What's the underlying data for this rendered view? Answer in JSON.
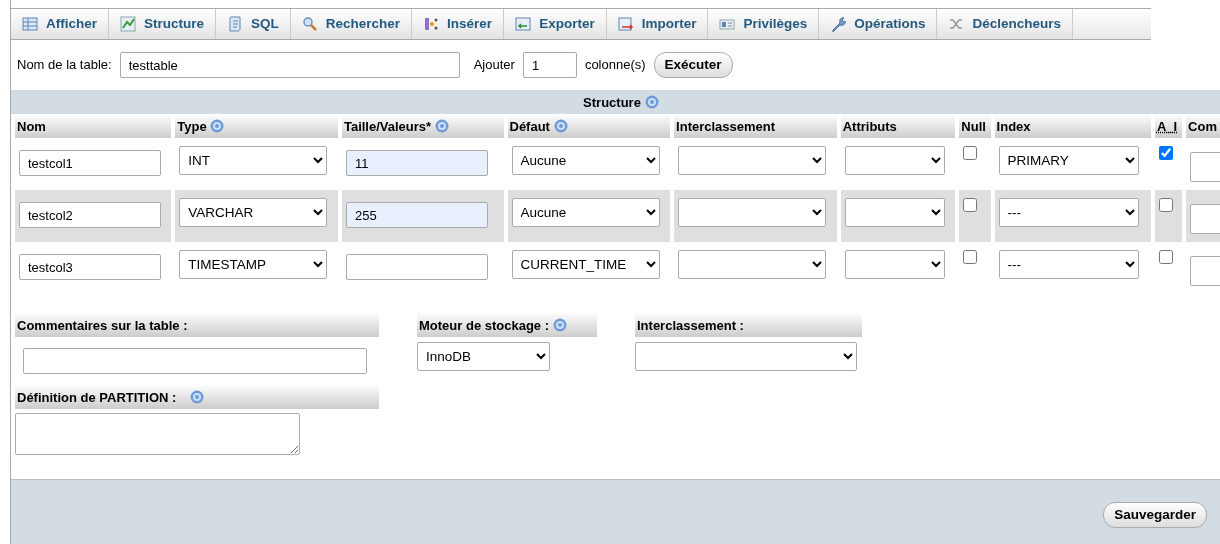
{
  "tabs": [
    {
      "label": "Afficher",
      "selected": false
    },
    {
      "label": "Structure",
      "selected": false
    },
    {
      "label": "SQL",
      "selected": false
    },
    {
      "label": "Rechercher",
      "selected": false
    },
    {
      "label": "Insérer",
      "selected": false
    },
    {
      "label": "Exporter",
      "selected": false
    },
    {
      "label": "Importer",
      "selected": false
    },
    {
      "label": "Privilèges",
      "selected": false
    },
    {
      "label": "Opérations",
      "selected": false
    },
    {
      "label": "Déclencheurs",
      "selected": false
    }
  ],
  "table_name": {
    "label": "Nom de la table:",
    "value": "testtable"
  },
  "add_columns": {
    "label": "Ajouter",
    "value": "1",
    "suffix": "colonne(s)",
    "button": "Exécuter"
  },
  "structure": {
    "title": "Structure",
    "help": true,
    "columns": [
      {
        "label": "Nom",
        "help": false
      },
      {
        "label": "Type",
        "help": true
      },
      {
        "label": "Taille/Valeurs*",
        "help": true
      },
      {
        "label": "Défaut",
        "help": true
      },
      {
        "label": "Interclassement",
        "help": false
      },
      {
        "label": "Attributs",
        "help": false
      },
      {
        "label": "Null",
        "help": false
      },
      {
        "label": "Index",
        "help": false
      },
      {
        "label": "A_I",
        "help": false
      },
      {
        "label": "Com",
        "help": false
      }
    ],
    "rows": [
      {
        "name": "testcol1",
        "type": "INT",
        "length": "11",
        "default": "Aucune",
        "null": false,
        "index": "PRIMARY",
        "ai": true
      },
      {
        "name": "testcol2",
        "type": "VARCHAR",
        "length": "255",
        "default": "Aucune",
        "null": false,
        "index": "---",
        "ai": false
      },
      {
        "name": "testcol3",
        "type": "TIMESTAMP",
        "default": "CURRENT_TIME",
        "null": false,
        "index": "---",
        "ai": false
      }
    ]
  },
  "table_comments": {
    "label": "Commentaires sur la table :"
  },
  "storage_engine": {
    "label": "Moteur de stockage :",
    "help": true,
    "value": "InnoDB"
  },
  "collation": {
    "label": "Interclassement :"
  },
  "partition": {
    "label": "Définition de PARTITION :",
    "help": true
  },
  "save_button": "Sauvegarder"
}
